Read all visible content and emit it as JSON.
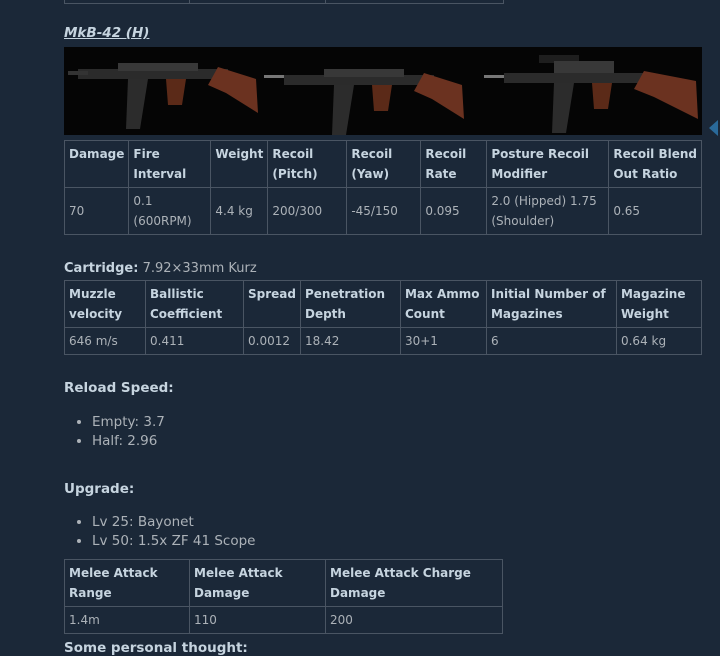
{
  "gun": {
    "title": "MkB-42 (H)",
    "image_alt": "MkB-42 rifle variants"
  },
  "stats_table": {
    "headers": [
      "Damage",
      "Fire Interval",
      "Weight",
      "Recoil (Pitch)",
      "Recoil (Yaw)",
      "Recoil Rate",
      "Posture Recoil Modifier",
      "Recoil Blend Out Ratio"
    ],
    "row": [
      "70",
      "0.1 (600RPM)",
      "4.4 kg",
      "200/300",
      "-45/150",
      "0.095",
      "2.0 (Hipped) 1.75 (Shoulder)",
      "0.65"
    ]
  },
  "cartridge": {
    "label": "Cartridge:",
    "value": "7.92×33mm Kurz"
  },
  "ammo_table": {
    "headers": [
      "Muzzle velocity",
      "Ballistic Coefficient",
      "Spread",
      "Penetration Depth",
      "Max Ammo Count",
      "Initial Number of Magazines",
      "Magazine Weight"
    ],
    "row": [
      "646 m/s",
      "0.411",
      "0.0012",
      "18.42",
      "30+1",
      "6",
      "0.64 kg"
    ]
  },
  "reload": {
    "title": "Reload Speed:",
    "items": [
      "Empty: 3.7",
      "Half: 2.96"
    ]
  },
  "upgrade": {
    "title": "Upgrade:",
    "items": [
      "Lv 25: Bayonet",
      "Lv 50: 1.5x ZF 41 Scope"
    ]
  },
  "melee_table": {
    "headers": [
      "Melee Attack Range",
      "Melee Attack Damage",
      "Melee Attack Charge Damage"
    ],
    "row": [
      "1.4m",
      "110",
      "200"
    ]
  },
  "thoughts": {
    "title": "Some personal thought:"
  },
  "colors": {
    "background": "#1b2838",
    "border": "#4a5563",
    "text": "#acb2b8",
    "heading": "#c6d4df"
  }
}
